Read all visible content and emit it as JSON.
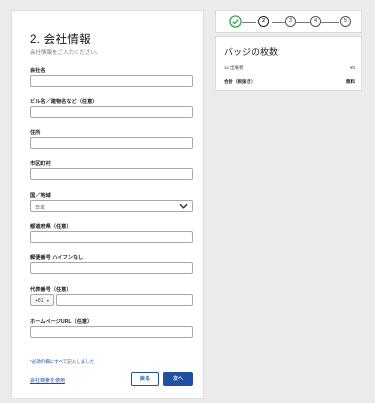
{
  "form": {
    "title": "2. 会社情報",
    "subtitle": "会社情報をご入力ください。",
    "fields": [
      {
        "label": "会社名"
      },
      {
        "label": "ビル名／建物名など（任意）"
      },
      {
        "label": "住所"
      },
      {
        "label": "市区町村"
      },
      {
        "label": "国／地域",
        "selected": "日本"
      },
      {
        "label": "都道府県（任意）"
      },
      {
        "label": "郵便番号 ハイフンなし"
      },
      {
        "label": "代表番号（任意）",
        "prefix": "+81"
      },
      {
        "label": "ホームページURL（任意）"
      }
    ],
    "required_note": "*必須の欄にすべて記入しました",
    "find_company_link": "会社検索を使用",
    "back_label": "戻る",
    "next_label": "次へ"
  },
  "stepper": {
    "steps": [
      "1",
      "2",
      "3",
      "4",
      "5"
    ],
    "current": 2
  },
  "summary": {
    "title": "バッジの枚数",
    "rows": [
      {
        "label": "1x 出展者",
        "value": "¥0"
      },
      {
        "label": "合計（税抜き）",
        "value": "無料"
      }
    ]
  },
  "colors": {
    "accent": "#1f4fa0",
    "done_green": "#2e9e4a"
  }
}
